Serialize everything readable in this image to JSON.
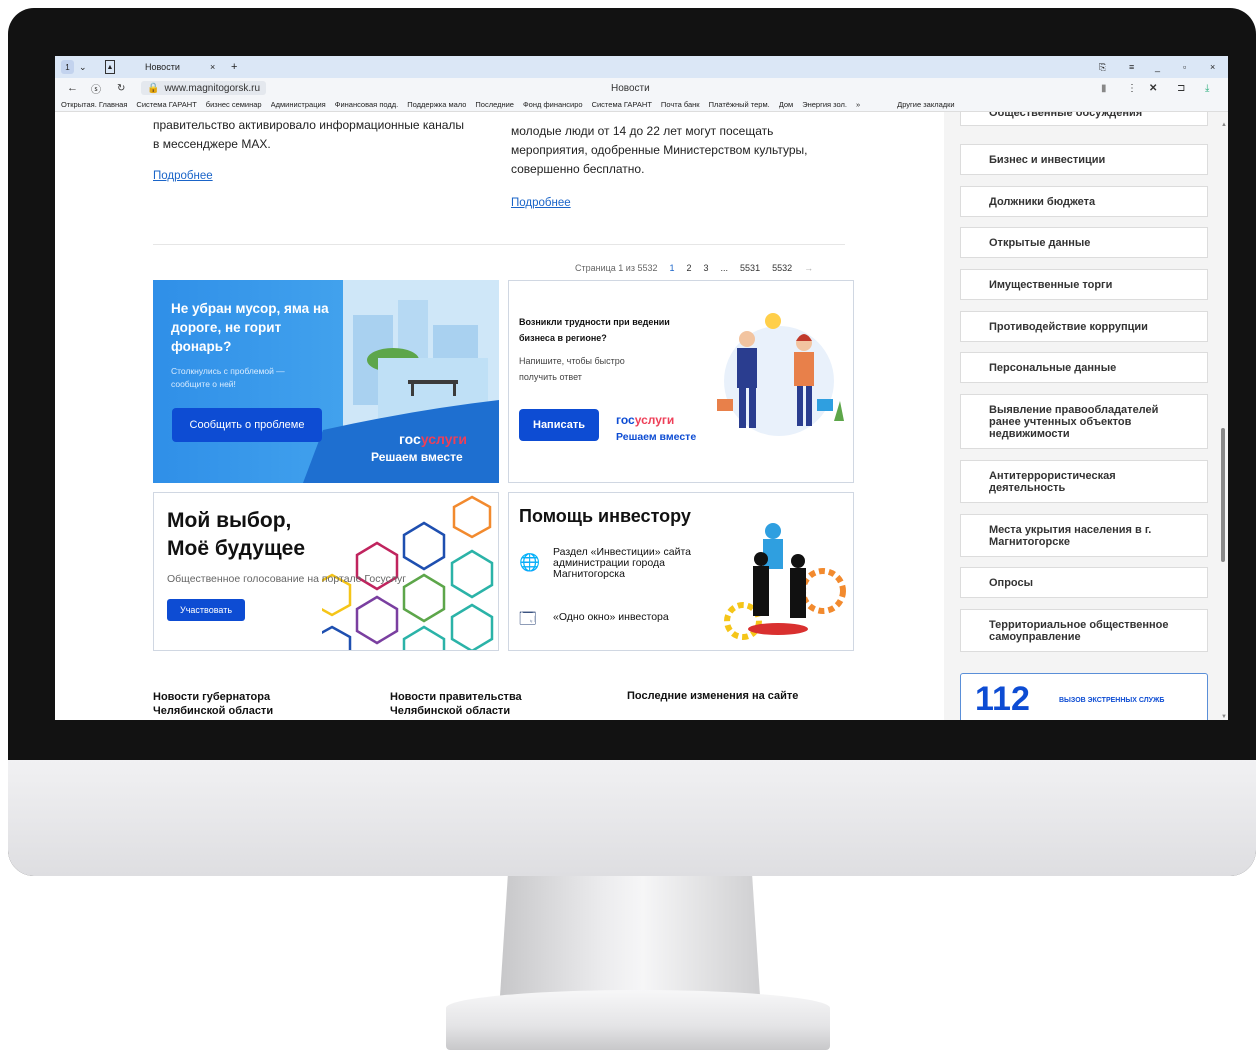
{
  "browser": {
    "tab_count": "1",
    "tab_title": "Новости",
    "url": "www.magnitogorsk.ru",
    "page_title": "Новости"
  },
  "bookmarks": [
    "Открытая. Главная",
    "Система ГАРАНТ",
    "бизнес семинар",
    "Администрация",
    "Финансовая подд.",
    "Поддержка мало",
    "Последние",
    "Фонд финансиро",
    "Система ГАРАНТ",
    "Почта банк",
    "Платёжный терм.",
    "Дом",
    "Энергия зол.",
    "»",
    "Другие закладки"
  ],
  "news": {
    "left_text": "правительство активировало информационные каналы\nв мессенджере MAX.",
    "left_link": "Подробнее",
    "right_text": "молодые люди от 14 до 22 лет могут посещать\nмероприятия, одобренные Министерством культуры,\nсовершенно бесплатно.",
    "right_link": "Подробнее"
  },
  "pager": {
    "label": "Страница 1 из 5532",
    "pages": [
      "1",
      "2",
      "3",
      "...",
      "5531",
      "5532"
    ],
    "next": "→"
  },
  "banner1": {
    "title": "Не убран мусор, яма на дороге, не горит фонарь?",
    "subtitle": "Столкнулись с проблемой — сообщите о ней!",
    "button": "Сообщить о проблеме",
    "logo_a": "гос",
    "logo_b": "услуги",
    "slogan": "Решаем вместе"
  },
  "banner2": {
    "title": "Возникли трудности при ведении бизнеса в регионе?",
    "subtitle": "Напишите, чтобы быстро получить ответ",
    "button": "Написать",
    "logo_a": "гос",
    "logo_b": "услуги",
    "slogan": "Решаем вместе"
  },
  "banner3": {
    "title": "Мой выбор,\nМоё будущее",
    "subtitle": "Общественное голосование на портале Госуслуг",
    "button": "Участвовать"
  },
  "banner4": {
    "title": "Помощь инвестору",
    "item1": "Раздел «Инвестиции» сайта администрации города Магнитогорска",
    "item2": "«Одно окно» инвестора"
  },
  "footer": {
    "col1": "Новости губернатора\nЧелябинской области",
    "col2": "Новости правительства\nЧелябинской области",
    "col3": "Последние изменения на сайте"
  },
  "sidebar": {
    "items": [
      "Общественные обсуждения",
      "Бизнес и инвестиции",
      "Должники бюджета",
      "Открытые данные",
      "Имущественные торги",
      "Противодействие коррупции",
      "Персональные данные",
      "Выявление правообладателей ранее учтенных объектов недвижимости",
      "Антитеррористическая деятельность",
      "Места укрытия населения в г. Магнитогорске",
      "Опросы",
      "Территориальное общественное самоуправление"
    ],
    "emergency_number": "112",
    "emergency_label": "ВЫЗОВ ЭКСТРЕННЫХ СЛУЖБ"
  },
  "colors": {
    "accent": "#1a64c8",
    "gosuslugi_red": "#ee3f58",
    "button_blue": "#0d4cd3"
  }
}
